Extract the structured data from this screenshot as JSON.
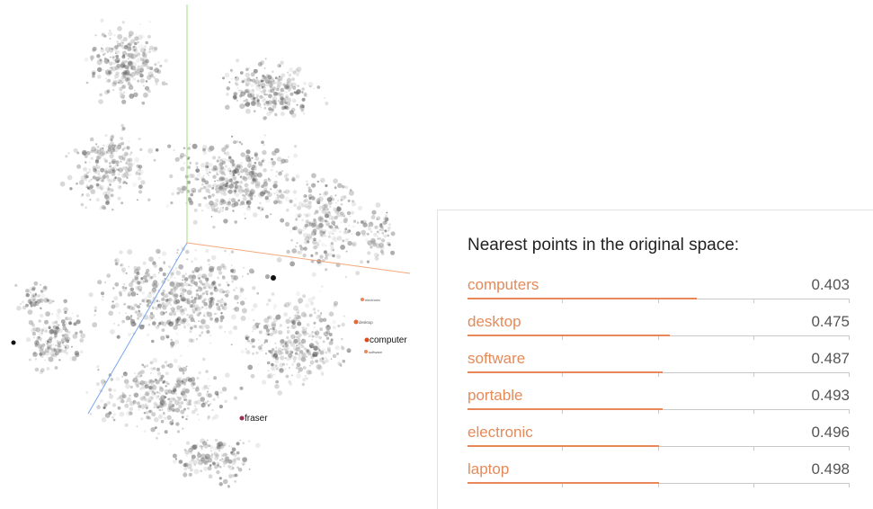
{
  "projection": {
    "labels": {
      "computer": "computer",
      "fraser": "fraser",
      "electronic": "electronic",
      "desktop": "desktop",
      "software": "software"
    },
    "colors": {
      "axis_x": "#f4a97c",
      "axis_y": "#9fe07b",
      "axis_z": "#7aa7ef",
      "point": "#6e6e6e",
      "highlight": "#e8875a",
      "selected": "#d94a1c"
    }
  },
  "nearest": {
    "title": "Nearest points in the original space:",
    "items": [
      {
        "word": "computers",
        "distance": "0.403",
        "bar_fraction": 0.6
      },
      {
        "word": "desktop",
        "distance": "0.475",
        "bar_fraction": 0.53
      },
      {
        "word": "software",
        "distance": "0.487",
        "bar_fraction": 0.51
      },
      {
        "word": "portable",
        "distance": "0.493",
        "bar_fraction": 0.51
      },
      {
        "word": "electronic",
        "distance": "0.496",
        "bar_fraction": 0.5
      },
      {
        "word": "laptop",
        "distance": "0.498",
        "bar_fraction": 0.5
      }
    ]
  }
}
